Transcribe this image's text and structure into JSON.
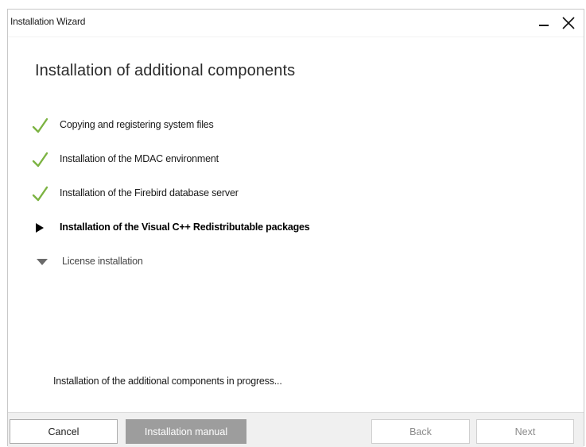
{
  "window": {
    "title": "Installation Wizard",
    "minimize_icon": "minimize-icon",
    "close_icon": "close-icon"
  },
  "heading": "Installation of additional components",
  "steps": [
    {
      "label": "Copying and registering system files",
      "state": "done",
      "icon": "checkmark-icon"
    },
    {
      "label": "Installation of the MDAC environment",
      "state": "done",
      "icon": "checkmark-icon"
    },
    {
      "label": "Installation of the Firebird database server",
      "state": "done",
      "icon": "checkmark-icon"
    },
    {
      "label": "Installation of the Visual C++ Redistributable packages",
      "state": "current",
      "icon": "play-arrow-icon"
    },
    {
      "label": "License installation",
      "state": "pending",
      "icon": "down-triangle-icon"
    }
  ],
  "status": "Installation of the additional components in progress...",
  "footer": {
    "cancel_label": "Cancel",
    "manual_label": "Installation manual",
    "back_label": "Back",
    "next_label": "Next"
  },
  "colors": {
    "check_green": "#7cb342",
    "manual_button_bg": "#9d9d9d",
    "footer_bg": "#f0f0f0"
  }
}
